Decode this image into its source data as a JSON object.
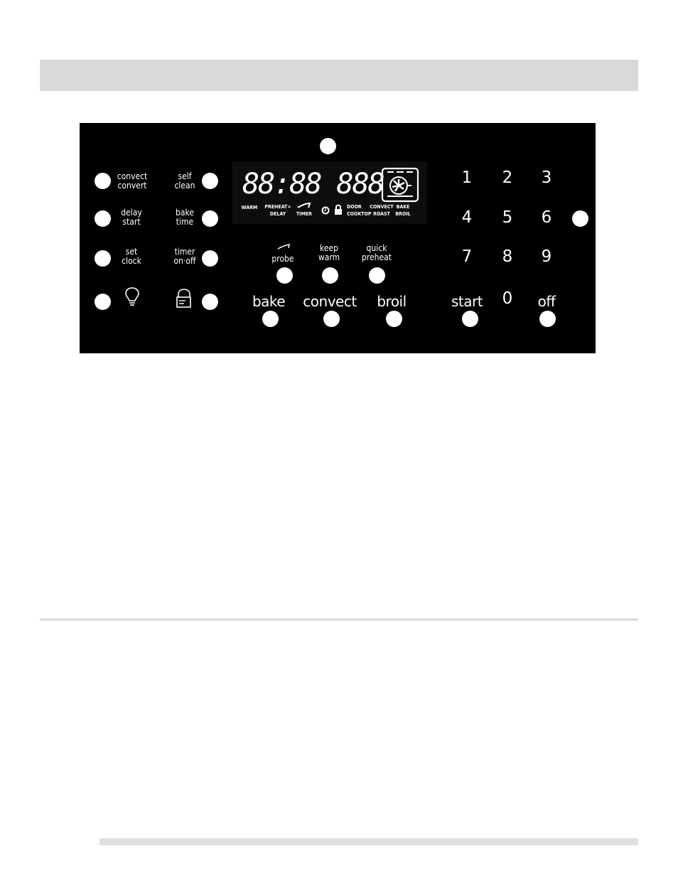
{
  "page": {
    "header_bar": "",
    "divider": "",
    "footer_bar": ""
  },
  "panel": {
    "left_buttons": [
      {
        "line1": "convect",
        "line2": "convert"
      },
      {
        "line1": "self",
        "line2": "clean"
      },
      {
        "line1": "delay",
        "line2": "start"
      },
      {
        "line1": "bake",
        "line2": "time"
      },
      {
        "line1": "set",
        "line2": "clock"
      },
      {
        "line1": "timer",
        "line2": "on·off"
      }
    ],
    "icons": {
      "light": "light-bulb-icon",
      "lock": "control-lock-icon",
      "probe": "probe-icon",
      "oven_fan": "convection-fan-icon"
    },
    "display": {
      "digits": "88:88 888",
      "indicators": [
        {
          "line1": "WARM",
          "line2": ""
        },
        {
          "line1": "PREHEAT+",
          "line2": "DELAY"
        },
        {
          "line1": "",
          "line2": "TIMER"
        },
        {
          "line1": "DOOR",
          "line2": "COOKTOP"
        },
        {
          "line1": "CONVECT",
          "line2": "ROAST"
        },
        {
          "line1": "BAKE",
          "line2": "BROIL"
        }
      ]
    },
    "mode_buttons_small": [
      {
        "line1": "",
        "line2": "probe"
      },
      {
        "line1": "keep",
        "line2": "warm"
      },
      {
        "line1": "quick",
        "line2": "preheat"
      }
    ],
    "mode_buttons_large": [
      "bake",
      "convect",
      "broil"
    ],
    "keypad": [
      "1",
      "2",
      "3",
      "4",
      "5",
      "6",
      "7",
      "8",
      "9",
      "0"
    ],
    "start_label": "start",
    "off_label": "off"
  }
}
